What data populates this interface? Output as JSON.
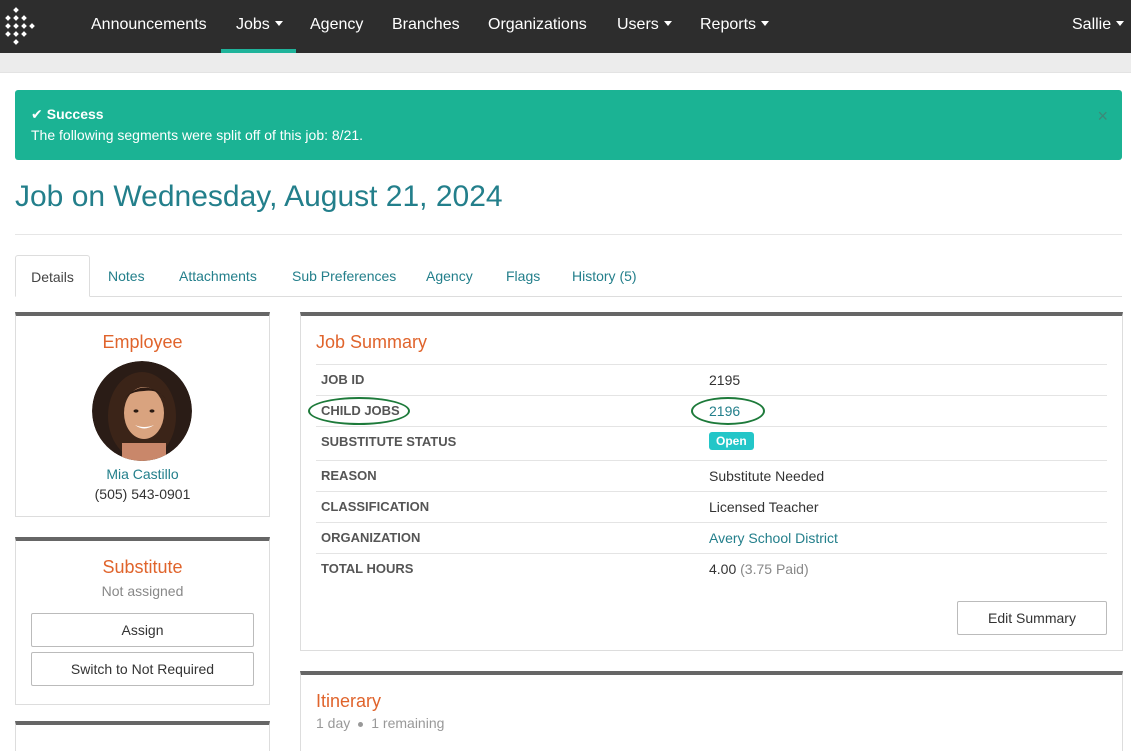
{
  "nav": {
    "items": [
      {
        "label": "Announcements",
        "dropdown": false
      },
      {
        "label": "Jobs",
        "dropdown": true
      },
      {
        "label": "Agency",
        "dropdown": false
      },
      {
        "label": "Branches",
        "dropdown": false
      },
      {
        "label": "Organizations",
        "dropdown": false
      },
      {
        "label": "Users",
        "dropdown": true
      },
      {
        "label": "Reports",
        "dropdown": true
      }
    ],
    "active": "Jobs",
    "user": "Sallie"
  },
  "alert": {
    "title": "Success",
    "message": "The following segments were split off of this job: 8/21.",
    "close": "×"
  },
  "page": {
    "title": "Job on Wednesday, August 21, 2024"
  },
  "tabs": [
    "Details",
    "Notes",
    "Attachments",
    "Sub Preferences",
    "Agency",
    "Flags",
    "History (5)"
  ],
  "employee": {
    "heading": "Employee",
    "name": "Mia Castillo",
    "phone": "(505) 543-0901"
  },
  "substitute": {
    "heading": "Substitute",
    "status": "Not assigned",
    "assign_label": "Assign",
    "not_required_label": "Switch to Not Required"
  },
  "summary": {
    "heading": "Job Summary",
    "rows": [
      {
        "label": "JOB ID",
        "value": "2195"
      },
      {
        "label": "CHILD JOBS",
        "value": "2196"
      },
      {
        "label": "SUBSTITUTE STATUS",
        "value": "Open"
      },
      {
        "label": "REASON",
        "value": "Substitute Needed"
      },
      {
        "label": "CLASSIFICATION",
        "value": "Licensed Teacher"
      },
      {
        "label": "ORGANIZATION",
        "value": "Avery School District"
      },
      {
        "label": "TOTAL HOURS",
        "value": "4.00",
        "extra": "(3.75 Paid)"
      }
    ],
    "edit_label": "Edit Summary"
  },
  "itinerary": {
    "heading": "Itinerary",
    "days": "1 day",
    "remaining": "1 remaining"
  },
  "colors": {
    "navbar": "#2d2d2d",
    "accent": "#1fb39a",
    "alert": "#1bb394",
    "link": "#237f8b",
    "heading": "#e0642c",
    "badge_open": "#23c6c8",
    "annotation_ellipse": "#1d7a3a"
  }
}
